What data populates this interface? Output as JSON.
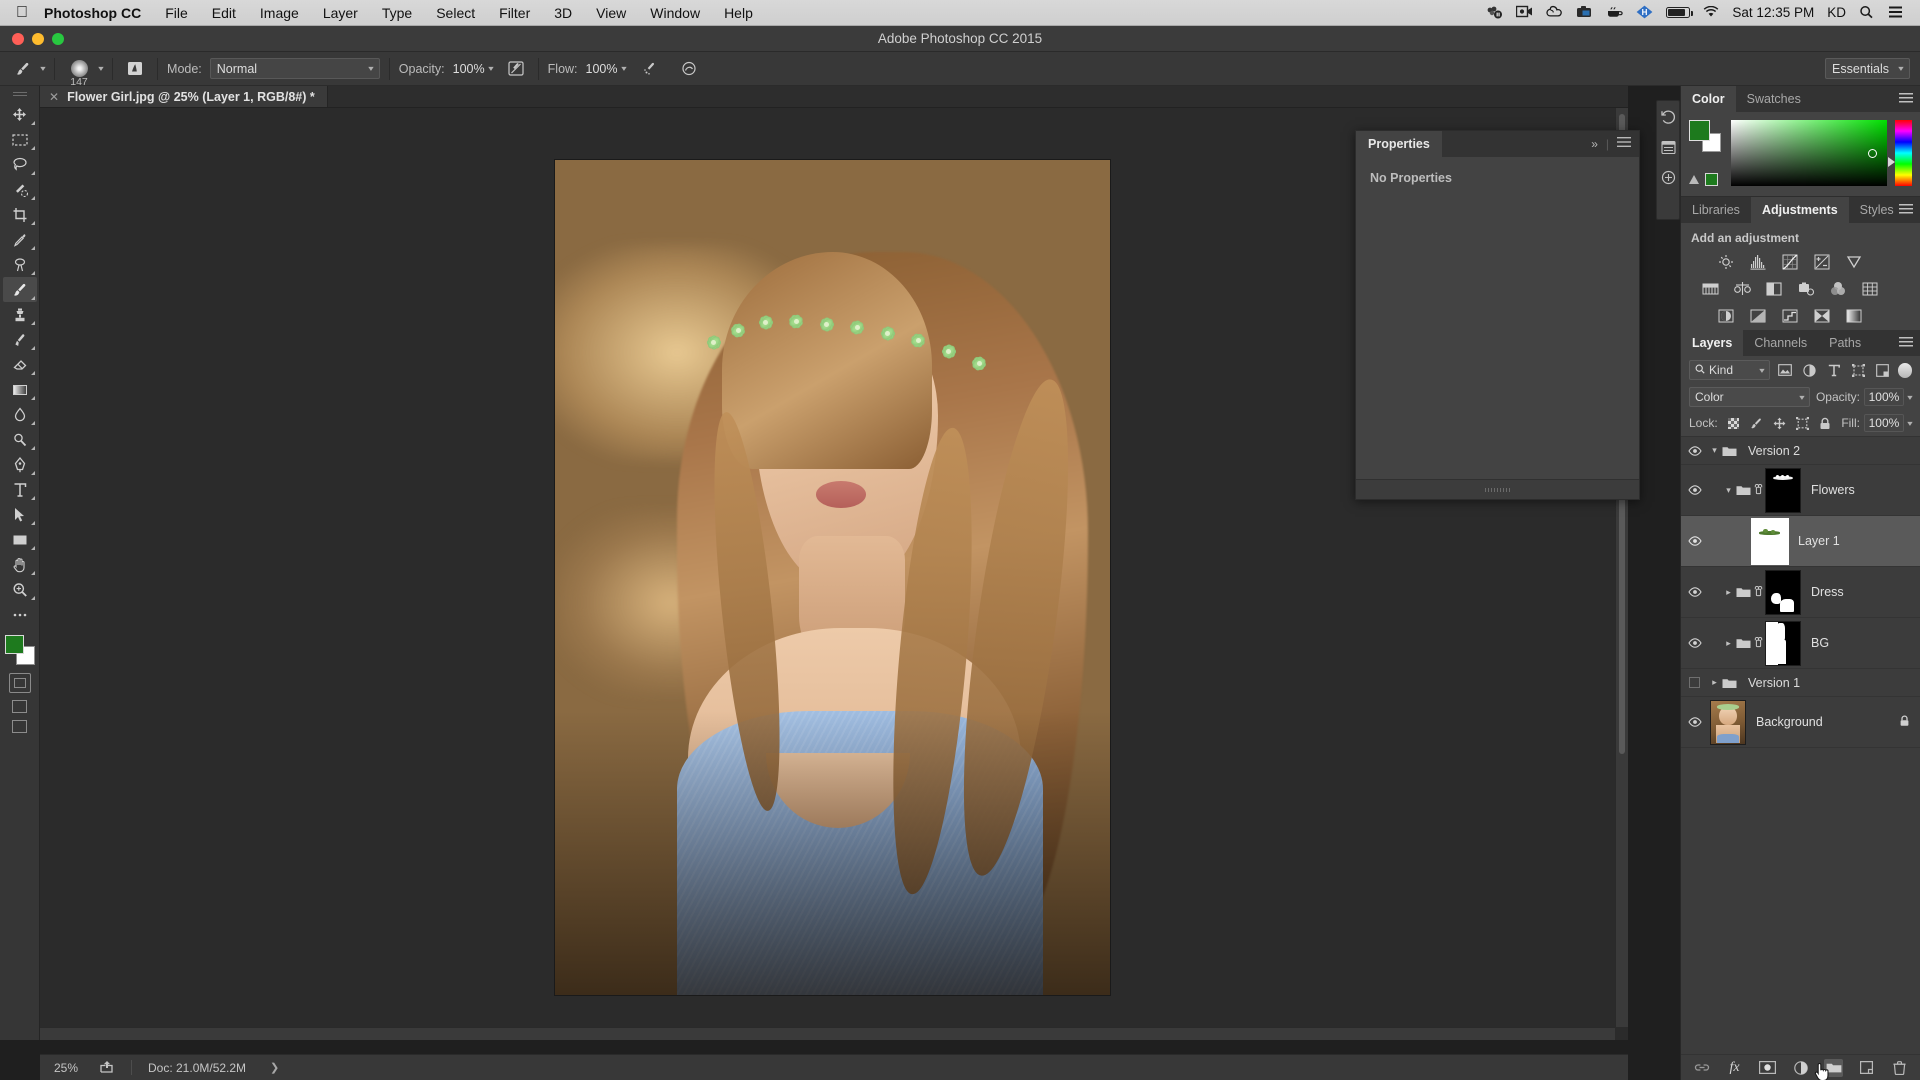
{
  "macbar": {
    "apple_icon": "apple-logo-icon",
    "app_name": "Photoshop CC",
    "menus": [
      "File",
      "Edit",
      "Image",
      "Layer",
      "Type",
      "Select",
      "Filter",
      "3D",
      "View",
      "Window",
      "Help"
    ],
    "tray_icons": [
      "sound-meter-icon",
      "screen-record-icon",
      "creative-cloud-icon",
      "camera-icon",
      "coffee-cup-icon",
      "hyperdock-icon",
      "battery-icon",
      "wifi-icon",
      "spotlight-search-icon",
      "control-center-icon"
    ],
    "clock": "Sat 12:35 PM",
    "user_initials": "KD"
  },
  "titlebar": {
    "title": "Adobe Photoshop CC 2015",
    "traffic_lights": [
      "close-button",
      "minimize-button",
      "zoom-button"
    ]
  },
  "options_bar": {
    "tool_icon": "brush-tool-icon",
    "brush_size": "147",
    "tablet_pressure_icon": "tablet-pressure-size-icon",
    "mode_label": "Mode:",
    "mode_value": "Normal",
    "opacity_label": "Opacity:",
    "opacity_value": "100%",
    "opacity_pressure_icon": "pressure-opacity-icon",
    "flow_label": "Flow:",
    "flow_value": "100%",
    "airbrush_icon": "airbrush-icon",
    "smoothing_icon": "smoothing-icon",
    "workspace": "Essentials"
  },
  "tab": {
    "close_icon": "close-tab-icon",
    "title": "Flower Girl.jpg @ 25% (Layer 1, RGB/8#) *"
  },
  "toolbox": {
    "tools": [
      {
        "name": "move-tool",
        "icon": "move-icon"
      },
      {
        "name": "rectangular-marquee-tool",
        "icon": "marquee-icon"
      },
      {
        "name": "lasso-tool",
        "icon": "lasso-icon"
      },
      {
        "name": "quick-selection-tool",
        "icon": "quick-select-icon"
      },
      {
        "name": "crop-tool",
        "icon": "crop-icon"
      },
      {
        "name": "eyedropper-tool",
        "icon": "eyedropper-icon"
      },
      {
        "name": "spot-healing-brush-tool",
        "icon": "healing-icon"
      },
      {
        "name": "brush-tool",
        "icon": "brush-icon"
      },
      {
        "name": "clone-stamp-tool",
        "icon": "stamp-icon"
      },
      {
        "name": "history-brush-tool",
        "icon": "history-brush-icon"
      },
      {
        "name": "eraser-tool",
        "icon": "eraser-icon"
      },
      {
        "name": "gradient-tool",
        "icon": "gradient-icon"
      },
      {
        "name": "blur-tool",
        "icon": "blur-drop-icon"
      },
      {
        "name": "dodge-tool",
        "icon": "dodge-icon"
      },
      {
        "name": "pen-tool",
        "icon": "pen-icon"
      },
      {
        "name": "type-tool",
        "icon": "type-icon"
      },
      {
        "name": "path-selection-tool",
        "icon": "path-select-icon"
      },
      {
        "name": "rectangle-tool",
        "icon": "rectangle-icon"
      },
      {
        "name": "hand-tool",
        "icon": "hand-icon"
      },
      {
        "name": "zoom-tool",
        "icon": "zoom-icon"
      },
      {
        "name": "edit-toolbar",
        "icon": "ellipsis-icon"
      }
    ],
    "foreground_color": "#1e7a1e",
    "background_color": "#ffffff",
    "screen_mode_icon": "screen-mode-icon",
    "quick_mask_icon": "quick-mask-icon"
  },
  "canvas": {
    "image_alt": "portrait of a girl with a green flower crown",
    "zoom": "25%"
  },
  "statusbar": {
    "zoom": "25%",
    "share_icon": "share-icon",
    "doc_info": "Doc: 21.0M/52.2M",
    "expand_icon": "expand-arrow-icon"
  },
  "rail": {
    "icons": [
      "history-panel-icon",
      "actions-panel-icon",
      "properties-panel-icon"
    ]
  },
  "properties_panel": {
    "tab_label": "Properties",
    "collapse_icon": "collapse-double-arrow-icon",
    "menu_icon": "panel-menu-icon",
    "empty_text": "No Properties"
  },
  "color_panel": {
    "tabs": [
      {
        "label": "Color",
        "active": true
      },
      {
        "label": "Swatches",
        "active": false
      }
    ],
    "foreground_color": "#1d7a1d",
    "background_color": "#ffffff",
    "out_of_gamut_icon": "gamut-warning-icon",
    "menu_icon": "panel-menu-icon"
  },
  "adjustments_panel": {
    "tabs": [
      {
        "label": "Libraries",
        "active": false
      },
      {
        "label": "Adjustments",
        "active": true
      },
      {
        "label": "Styles",
        "active": false
      }
    ],
    "title": "Add an adjustment",
    "rows": [
      [
        "brightness-contrast-icon",
        "levels-icon",
        "curves-icon",
        "exposure-icon",
        "vibrance-icon"
      ],
      [
        "hue-saturation-icon",
        "color-balance-icon",
        "black-white-icon",
        "photo-filter-icon",
        "channel-mixer-icon",
        "color-lookup-icon"
      ],
      [
        "invert-icon",
        "posterize-icon",
        "threshold-icon",
        "selective-color-icon",
        "gradient-map-icon"
      ]
    ],
    "menu_icon": "panel-menu-icon"
  },
  "layers_panel": {
    "tabs": [
      {
        "label": "Layers",
        "active": true
      },
      {
        "label": "Channels",
        "active": false
      },
      {
        "label": "Paths",
        "active": false
      }
    ],
    "menu_icon": "panel-menu-icon",
    "filter_label": "Kind",
    "filter_search_icon": "search-icon",
    "filter_icons": [
      "pixel-filter-icon",
      "adjustment-filter-icon",
      "type-filter-icon",
      "shape-filter-icon",
      "smart-object-filter-icon"
    ],
    "filter_toggle_icon": "filter-toggle-icon",
    "blend_mode": "Color",
    "opacity_label": "Opacity:",
    "opacity_value": "100%",
    "lock_label": "Lock:",
    "lock_icons": [
      "lock-transparent-pixels-icon",
      "lock-image-pixels-icon",
      "lock-position-icon",
      "lock-artboard-icon",
      "lock-all-icon"
    ],
    "fill_label": "Fill:",
    "fill_value": "100%",
    "layers": [
      {
        "name": "Version 2",
        "type": "group",
        "visible": true,
        "expanded": true,
        "selected": false,
        "indent": 0
      },
      {
        "name": "Flowers",
        "type": "group",
        "visible": true,
        "expanded": true,
        "selected": false,
        "indent": 1,
        "linked": true,
        "mask": "black-mask-with-white-flowers"
      },
      {
        "name": "Layer 1",
        "type": "pixel",
        "visible": true,
        "selected": true,
        "indent": 1,
        "thumb": "white-with-green-stroke"
      },
      {
        "name": "Dress",
        "type": "group",
        "visible": true,
        "expanded": false,
        "selected": false,
        "indent": 1,
        "linked": true,
        "mask": "black-mask-with-white-dress"
      },
      {
        "name": "BG",
        "type": "group",
        "visible": true,
        "expanded": false,
        "selected": false,
        "indent": 1,
        "linked": true,
        "mask": "black-mask-with-white-background"
      },
      {
        "name": "Version 1",
        "type": "group",
        "visible": false,
        "expanded": false,
        "selected": false,
        "indent": 0
      },
      {
        "name": "Background",
        "type": "pixel",
        "visible": true,
        "selected": false,
        "indent": 0,
        "locked": true,
        "thumb": "portrait-photo"
      }
    ],
    "footer_icons": [
      "link-layers-icon",
      "layer-style-fx-icon",
      "add-layer-mask-icon",
      "new-adjustment-layer-icon",
      "new-group-icon",
      "new-layer-icon",
      "delete-layer-icon"
    ]
  }
}
